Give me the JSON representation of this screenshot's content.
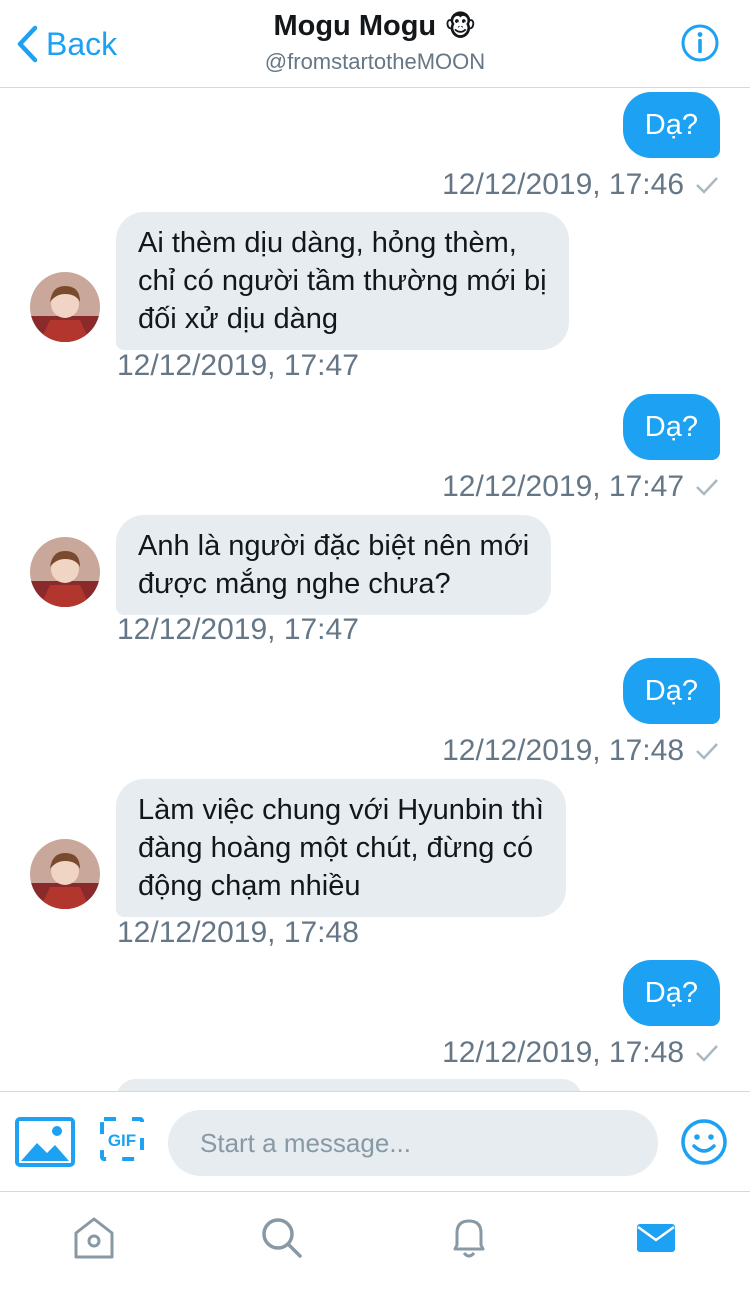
{
  "header": {
    "back_label": "Back",
    "title": "Mogu Mogu",
    "title_emoji": "🐵",
    "handle": "@fromstartotheMOON"
  },
  "messages": [
    {
      "direction": "out",
      "text": "Dạ?",
      "timestamp": "12/12/2019, 17:46"
    },
    {
      "direction": "in",
      "lines": [
        "Ai thèm dịu dàng, hỏng thèm,",
        "chỉ có người tầm thường mới bị",
        "đối xử dịu dàng"
      ],
      "timestamp": "12/12/2019, 17:47"
    },
    {
      "direction": "out",
      "text": "Dạ?",
      "timestamp": "12/12/2019, 17:47"
    },
    {
      "direction": "in",
      "lines": [
        "Anh là người đặc biệt nên mới",
        "được mắng nghe chưa?"
      ],
      "timestamp": "12/12/2019, 17:47"
    },
    {
      "direction": "out",
      "text": "Dạ?",
      "timestamp": "12/12/2019, 17:48"
    },
    {
      "direction": "in",
      "lines": [
        "Làm việc chung với Hyunbin thì",
        "đàng hoàng một chút, đừng có",
        "động chạm nhiều"
      ],
      "timestamp": "12/12/2019, 17:48"
    },
    {
      "direction": "out",
      "text": "Dạ?",
      "timestamp": "12/12/2019, 17:48"
    }
  ],
  "composer": {
    "placeholder": "Start a message...",
    "gif_label": "GIF"
  },
  "icons": {
    "back": "chevron-left-icon",
    "info": "info-icon",
    "media": "image-icon",
    "gif": "gif-icon",
    "emoji": "smiley-icon",
    "home": "home-icon",
    "search": "search-icon",
    "notifications": "bell-icon",
    "messages": "envelope-icon"
  },
  "colors": {
    "accent": "#1da1f2",
    "incoming_bubble": "#e6ecf0",
    "secondary_text": "#657786"
  }
}
